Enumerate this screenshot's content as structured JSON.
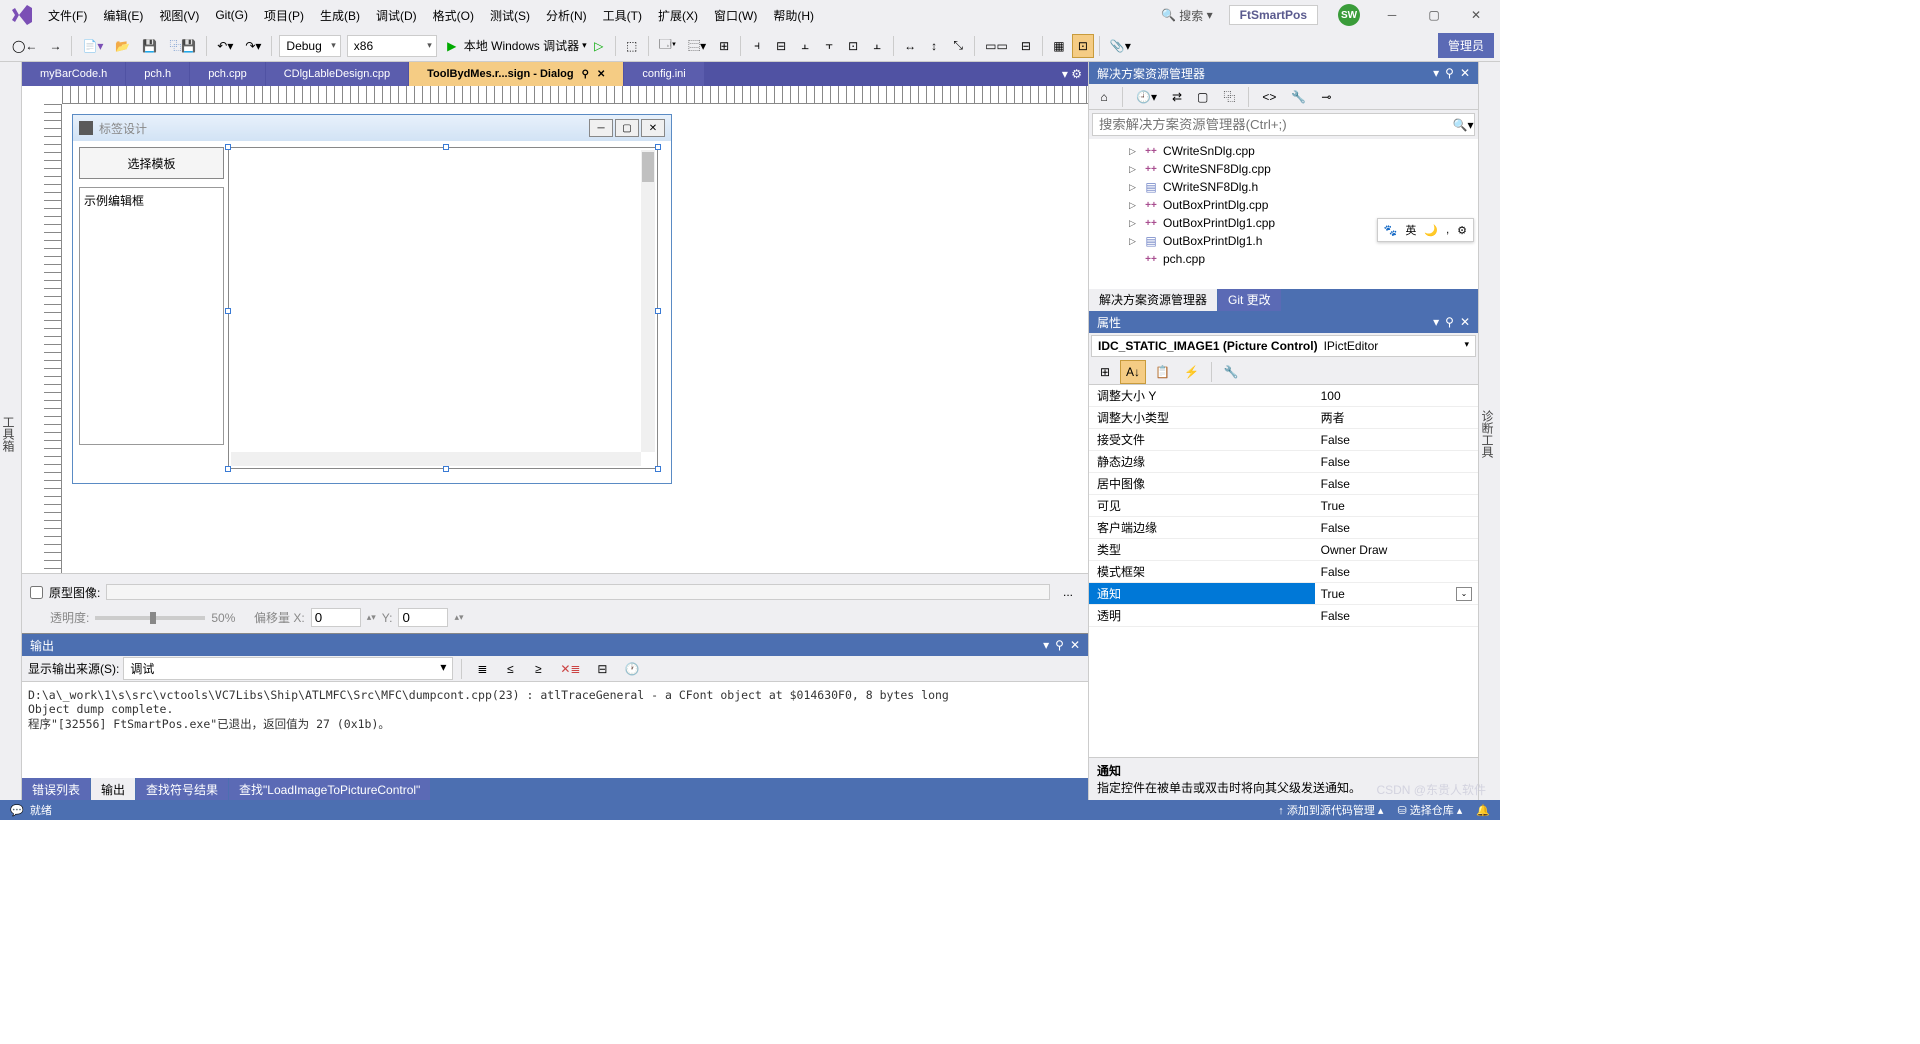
{
  "menubar": [
    "文件(F)",
    "编辑(E)",
    "视图(V)",
    "Git(G)",
    "项目(P)",
    "生成(B)",
    "调试(D)",
    "格式(O)",
    "测试(S)",
    "分析(N)",
    "工具(T)",
    "扩展(X)",
    "窗口(W)",
    "帮助(H)"
  ],
  "titlebar": {
    "search_placeholder": "搜索",
    "project": "FtSmartPos",
    "user_initials": "SW"
  },
  "toolbar": {
    "config": "Debug",
    "platform": "x86",
    "debugger": "本地 Windows 调试器",
    "admin": "管理员"
  },
  "side_tabs": {
    "left": "工具箱",
    "right": "诊断工具"
  },
  "doc_tabs": [
    {
      "label": "myBarCode.h",
      "active": false
    },
    {
      "label": "pch.h",
      "active": false
    },
    {
      "label": "pch.cpp",
      "active": false
    },
    {
      "label": "CDlgLableDesign.cpp",
      "active": false
    },
    {
      "label": "ToolBydMes.r...sign - Dialog",
      "active": true
    },
    {
      "label": "config.ini",
      "active": false
    }
  ],
  "dialog": {
    "title": "标签设计",
    "select_template": "选择模板",
    "edit_placeholder": "示例编辑框"
  },
  "designer_footer": {
    "prototype_label": "原型图像:",
    "opacity_label": "透明度:",
    "opacity_value": "50%",
    "offset_label": "偏移量 X:",
    "offset_x": "0",
    "offset_y_label": "Y:",
    "offset_y": "0"
  },
  "output": {
    "title": "输出",
    "source_label": "显示输出来源(S):",
    "source_value": "调试",
    "content": "D:\\a\\_work\\1\\s\\src\\vctools\\VC7Libs\\Ship\\ATLMFC\\Src\\MFC\\dumpcont.cpp(23) : atlTraceGeneral - a CFont object at $014630F0, 8 bytes long\nObject dump complete.\n程序\"[32556] FtSmartPos.exe\"已退出，返回值为 27 (0x1b)。",
    "tabs": [
      "错误列表",
      "输出",
      "查找符号结果",
      "查找\"LoadImageToPictureControl\""
    ],
    "active_tab": 1
  },
  "solution_explorer": {
    "title": "解决方案资源管理器",
    "search_placeholder": "搜索解决方案资源管理器(Ctrl+;)",
    "items": [
      {
        "name": "CWriteSnDlg.cpp",
        "type": "cpp"
      },
      {
        "name": "CWriteSNF8Dlg.cpp",
        "type": "cpp"
      },
      {
        "name": "CWriteSNF8Dlg.h",
        "type": "h"
      },
      {
        "name": "OutBoxPrintDlg.cpp",
        "type": "cpp"
      },
      {
        "name": "OutBoxPrintDlg1.cpp",
        "type": "cpp"
      },
      {
        "name": "OutBoxPrintDlg1.h",
        "type": "h"
      },
      {
        "name": "pch.cpp",
        "type": "cpp"
      }
    ],
    "tabs": [
      "解决方案资源管理器",
      "Git 更改"
    ]
  },
  "properties": {
    "title": "属性",
    "selector_name": "IDC_STATIC_IMAGE1 (Picture Control)",
    "selector_type": "IPictEditor",
    "rows": [
      {
        "name": "调整大小 Y",
        "value": "100"
      },
      {
        "name": "调整大小类型",
        "value": "两者"
      },
      {
        "name": "接受文件",
        "value": "False"
      },
      {
        "name": "静态边缘",
        "value": "False"
      },
      {
        "name": "居中图像",
        "value": "False"
      },
      {
        "name": "可见",
        "value": "True"
      },
      {
        "name": "客户端边缘",
        "value": "False"
      },
      {
        "name": "类型",
        "value": "Owner Draw"
      },
      {
        "name": "模式框架",
        "value": "False"
      },
      {
        "name": "通知",
        "value": "True",
        "selected": true
      },
      {
        "name": "透明",
        "value": "False"
      }
    ],
    "desc_title": "通知",
    "desc_text": "指定控件在被单击或双击时将向其父级发送通知。"
  },
  "statusbar": {
    "ready": "就绪",
    "source_control": "添加到源代码管理",
    "select_repo": "选择仓库"
  },
  "ime": {
    "lang": "英"
  },
  "watermark": "CSDN @东贵人软件"
}
